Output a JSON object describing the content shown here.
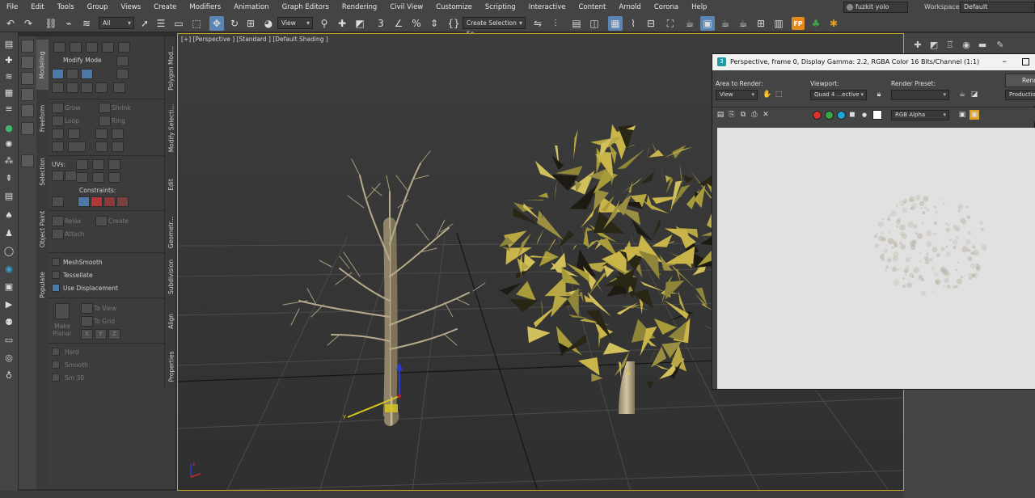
{
  "menu": [
    "File",
    "Edit",
    "Tools",
    "Group",
    "Views",
    "Create",
    "Modifiers",
    "Animation",
    "Graph Editors",
    "Rendering",
    "Civil View",
    "Customize",
    "Scripting",
    "Interactive",
    "Content",
    "Arnold",
    "Corona",
    "Help"
  ],
  "user": "fuzkit yolo",
  "workspaces_label": "Workspaces:",
  "workspace": "Default",
  "toolbar": {
    "selection_filter": "All",
    "ref_coord": "View",
    "named_selection_placeholder": "Create Selection Se"
  },
  "ribbon": {
    "tabs": [
      "Modeling",
      "Freeform",
      "Selection",
      "Object Paint",
      "Populate"
    ],
    "side_tabs": [
      "Polygon Mod...",
      "Modify Selecti...",
      "Edit",
      "Geometr...",
      "Subdivision",
      "Align",
      "Properties"
    ],
    "modify_mode": "Modify Mode",
    "grow": "Grow",
    "shrink": "Shrink",
    "loop": "Loop",
    "ring": "Ring",
    "uvs": "UVs:",
    "constraints": "Constraints:",
    "relax": "Relax",
    "create": "Create",
    "attach": "Attach",
    "meshsmooth": "MeshSmooth",
    "tessellate": "Tessellate",
    "use_displacement": "Use Displacement",
    "make_planar": "Make Planar",
    "to_view": "To View",
    "to_grid": "To Grid",
    "xyz": [
      "X",
      "Y",
      "Z"
    ],
    "hard": "Hard",
    "smooth": "Smooth",
    "smooth_30": "Sm 30"
  },
  "viewport": {
    "label": "[+] [Perspective ] [Standard ] [Default Shading ]",
    "axis_y": "y",
    "axis_z": "z"
  },
  "render_window": {
    "title": "Perspective, frame 0, Display Gamma: 2.2, RGBA Color 16 Bits/Channel (1:1)",
    "logo": "3",
    "area_to_render_label": "Area to Render:",
    "area_to_render": "View",
    "viewport_label": "Viewport:",
    "viewport": "Quad 4 ...ective",
    "render_preset_label": "Render Preset:",
    "render_preset": "",
    "render_button": "Render",
    "production": "Production",
    "channel": "RGB Alpha",
    "channel_colors": [
      "#d9312e",
      "#39a845",
      "#1ea5d8"
    ]
  },
  "colors": {
    "accent": "#5b86b3",
    "viewport_border": "#c8a030",
    "foliage": "#b8a845"
  }
}
